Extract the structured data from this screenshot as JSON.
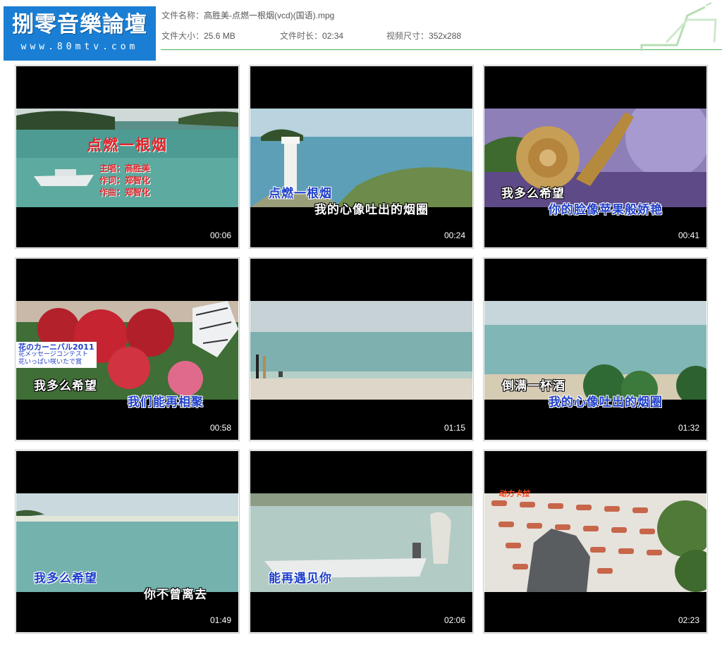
{
  "logo": {
    "title": "捌零音樂論壇",
    "url": "www.80mtv.com"
  },
  "file_info": {
    "name_label": "文件名称：",
    "name_value": "高胜美-点燃一根烟(vcd)(国语).mpg",
    "size_label": "文件大小：",
    "size_value": "25.6 MB",
    "duration_label": "文件时长：",
    "duration_value": "02:34",
    "dimensions_label": "视频尺寸：",
    "dimensions_value": "352x288"
  },
  "colors": {
    "accent_line": "#4caf50",
    "logo_bg": "#1a7fd4",
    "caption_blue": "#1f3fc9",
    "title_red": "#e0262b"
  },
  "thumbnails": [
    {
      "time": "00:06",
      "title": "点燃一根烟",
      "credits": [
        "主唱：高胜美",
        "作词：郑智化",
        "作曲：郑智化"
      ]
    },
    {
      "time": "00:24",
      "lines": [
        "点燃一根烟",
        "我的心像吐出的烟圈"
      ]
    },
    {
      "time": "00:41",
      "lines": [
        "我多么希望",
        "你的脸像苹果般娇艳"
      ]
    },
    {
      "time": "00:58",
      "lines": [
        "我多么希望",
        "我们能再相聚"
      ],
      "sign": [
        "花のカーニバル2011",
        "花メッセージコンテスト",
        "花いっぱい咲いたで賞"
      ]
    },
    {
      "time": "01:15",
      "lines": []
    },
    {
      "time": "01:32",
      "lines": [
        "倒满一杯酒",
        "我的心像吐出的烟圈"
      ]
    },
    {
      "time": "01:49",
      "lines": [
        "我多么希望",
        "你不曾离去"
      ]
    },
    {
      "time": "02:06",
      "lines": [
        "能再遇见你"
      ]
    },
    {
      "time": "02:23",
      "lines": [],
      "badge": "动力卡拉"
    }
  ]
}
